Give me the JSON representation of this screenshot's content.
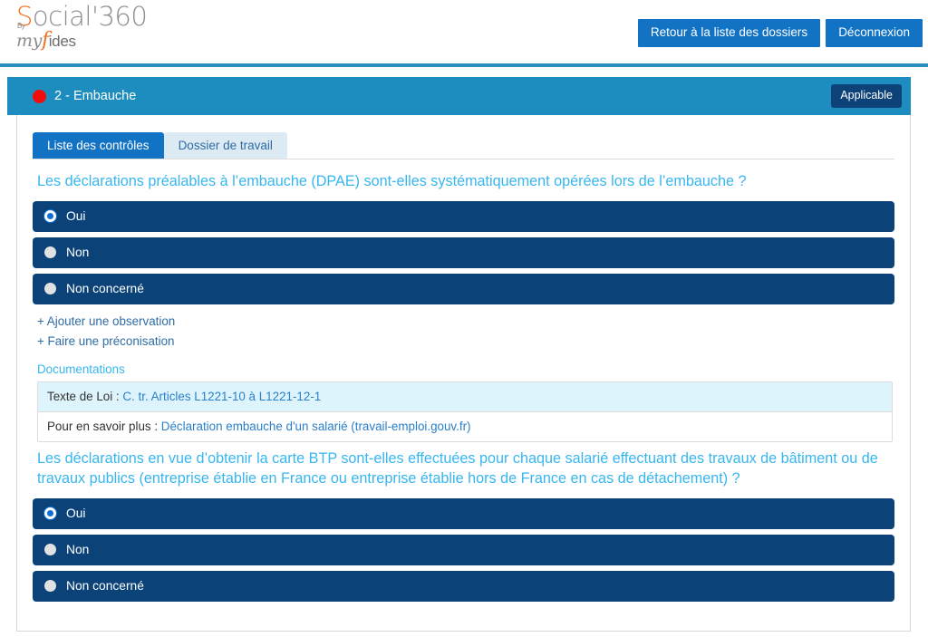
{
  "brand": {
    "name_part1": "S",
    "name_part2": "ocial'360",
    "by": "By",
    "my": "my",
    "f": "f",
    "ides": "ides"
  },
  "topbar": {
    "back_button": "Retour à la liste des dossiers",
    "logout_button": "Déconnexion"
  },
  "section": {
    "status_icon": "red-circle-icon",
    "title": "2 - Embauche",
    "applicable_badge": "Applicable"
  },
  "tabs": [
    {
      "label": "Liste des contrôles",
      "active": true
    },
    {
      "label": "Dossier de travail",
      "active": false
    }
  ],
  "questions": [
    {
      "text": "Les déclarations préalables à l’embauche (DPAE) sont-elles systématiquement opérées lors de l’embauche ?",
      "options": [
        {
          "label": "Oui",
          "selected": true
        },
        {
          "label": "Non",
          "selected": false
        },
        {
          "label": "Non concerné",
          "selected": false
        }
      ],
      "actions": [
        "+ Ajouter une observation",
        "+ Faire une préconisation"
      ],
      "documentations_label": "Documentations",
      "documentations": [
        {
          "prefix": "Texte de Loi : ",
          "link": "C. tr. Articles L1221-10 à L1221-12-1",
          "highlight": true
        },
        {
          "prefix": "Pour en savoir plus : ",
          "link": "Déclaration embauche d'un salarié (travail-emploi.gouv.fr)",
          "highlight": false
        }
      ]
    },
    {
      "text": "Les déclarations en vue d’obtenir la carte BTP sont-elles effectuées pour chaque salarié effectuant des travaux de bâtiment ou de travaux publics (entreprise établie en France ou entreprise établie hors de France en cas de détachement) ?",
      "options": [
        {
          "label": "Oui",
          "selected": true
        },
        {
          "label": "Non",
          "selected": false
        },
        {
          "label": "Non concerné",
          "selected": false
        }
      ]
    }
  ],
  "colors": {
    "accent_teal": "#1d8cbe",
    "navy": "#0b4379",
    "primary_blue": "#1273c4",
    "question_blue": "#37b6ef",
    "status_red": "#f20d0d",
    "doc_highlight": "#ddf4fd",
    "brand_orange": "#ee7326"
  }
}
